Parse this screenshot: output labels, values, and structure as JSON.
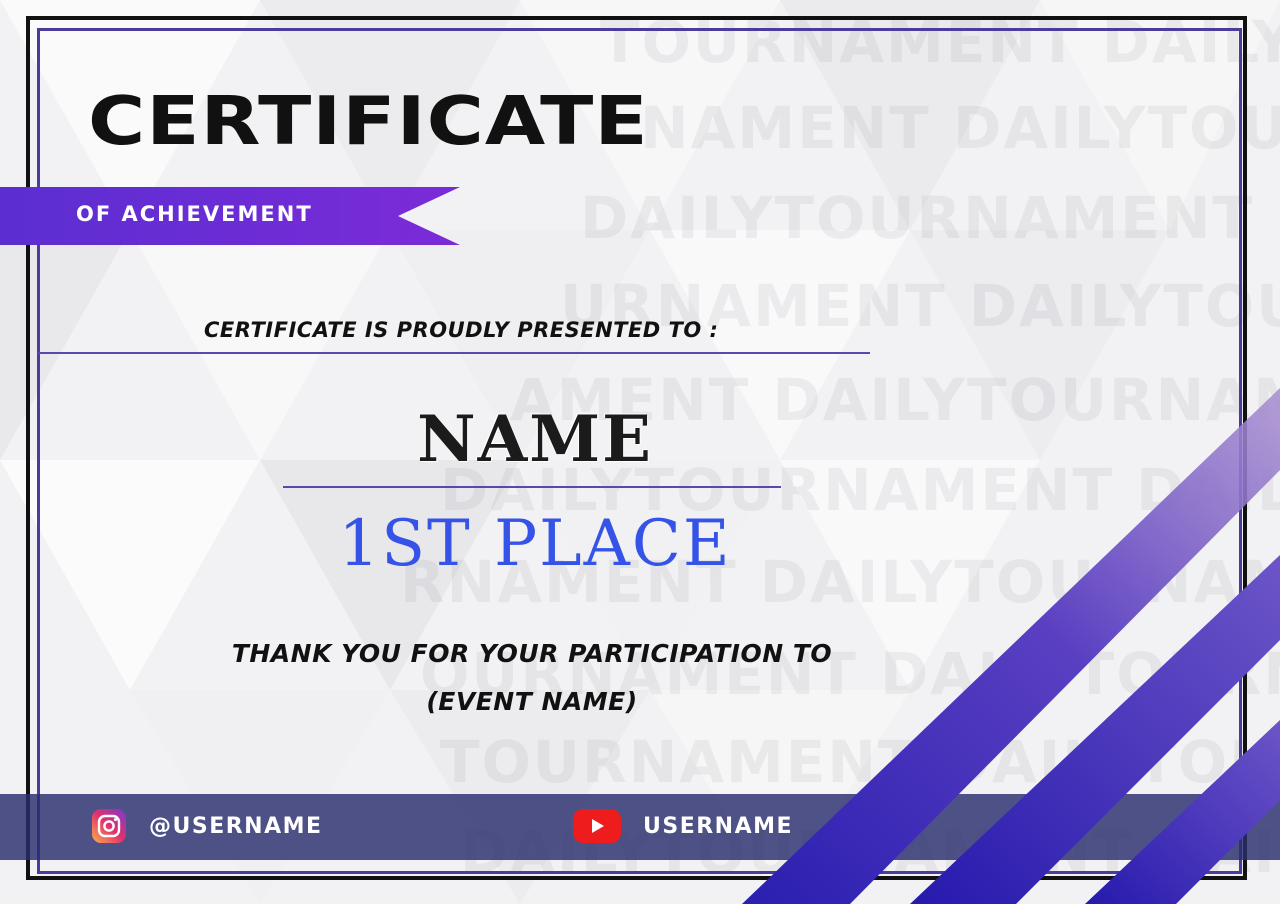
{
  "certificate": {
    "title": "CERTIFICATE",
    "subtitle": "OF ACHIEVEMENT",
    "presented_to": "CERTIFICATE IS PROUDLY PRESENTED TO :",
    "recipient_name": "NAME",
    "placement": "1ST PLACE",
    "thanks_line1": "THANK YOU FOR YOUR PARTICIPATION TO",
    "thanks_line2": "(EVENT NAME)"
  },
  "watermark": {
    "lines": [
      "TOURNAMENT DAILYTOURNAMENT DAILYTOURNAMENT",
      "NAMENT DAILYTOURNAMENT DAILYTOURNAMENT DAILY",
      "DAILYTOURNAMENT DAILYTOURNAMENT DAILYTOURNAMENT",
      "URNAMENT DAILYTOURNAMENT DAILYTOURNAMENT DAILY",
      "AMENT DAILYTOURNAMENT DAILYTOURNAMENT DAILY",
      "DAILYTOURNAMENT DAILYTOURNAMENT DAILYTOURNAMENT",
      "RNAMENT DAILYTOURNAMENT DAILYTOURNAMENT DAILY",
      "OURNAMENT DAILYTOURNAMENT DAILYTOURNAMENT",
      "TOURNAMENT DAILYTOURNAMENT DAILYTOURNAMENT",
      "DAILYTOURNAMENT DAILYTOURNAMENT DAILYTOURNAMENT"
    ]
  },
  "footer": {
    "instagram_handle": "@USERNAME",
    "youtube_handle": "USERNAME",
    "instagram_icon": "instagram-icon",
    "youtube_icon": "youtube-icon"
  },
  "colors": {
    "accent_purple": "#5a2fd6",
    "ribbon_start": "#5b2ed1",
    "ribbon_end": "#7b2bd8",
    "placement_blue": "#3553e6",
    "footer_bar": "#282d6e",
    "stripe": "#3a23b8"
  }
}
